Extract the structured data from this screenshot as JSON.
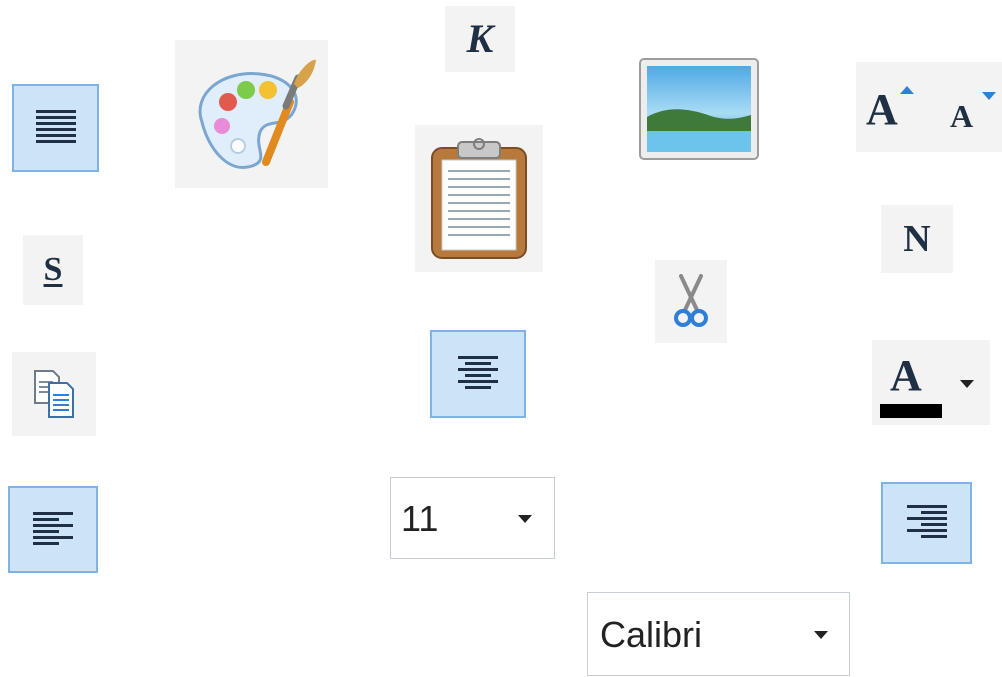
{
  "icons": {
    "italic_glyph": "K",
    "bold_glyph": "N",
    "underline_glyph": "S",
    "grow_font_glyph": "A",
    "shrink_font_glyph": "A",
    "font_color_glyph": "A"
  },
  "font_size_dropdown": {
    "value": "11"
  },
  "font_family_dropdown": {
    "value": "Calibri"
  },
  "colors": {
    "selected_fill": "#cde3f7",
    "selected_border": "#7fb3e6",
    "icon_dark": "#1f2f44",
    "accent_blue": "#2f7fd8",
    "font_color_bar": "#000000"
  }
}
